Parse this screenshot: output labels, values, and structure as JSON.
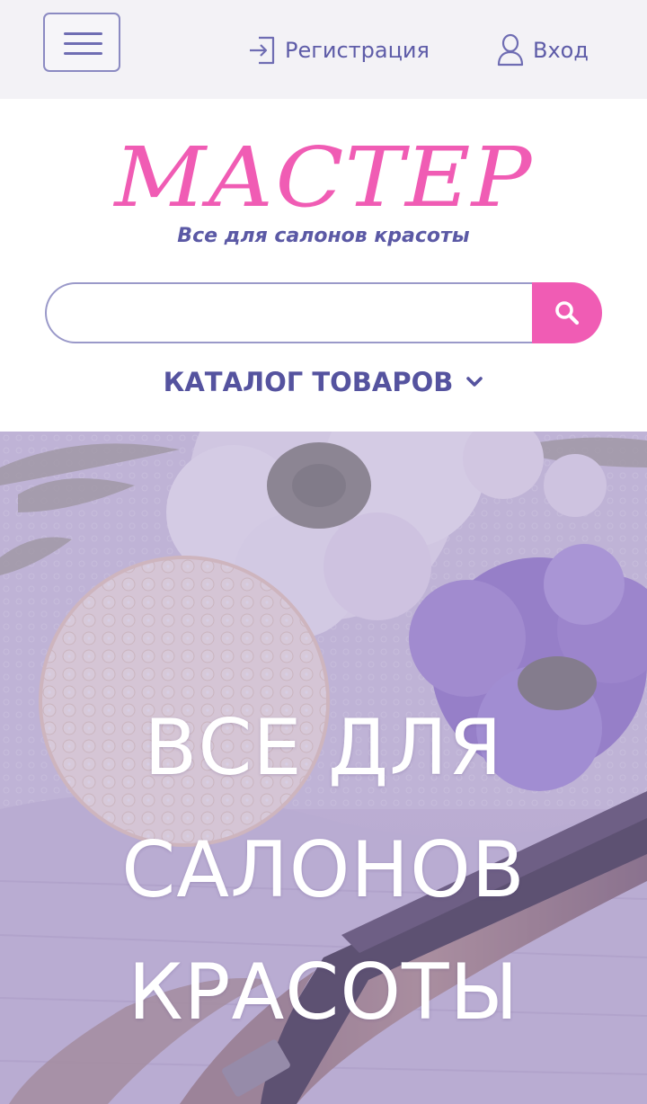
{
  "topbar": {
    "menu_label": "",
    "register_label": "Регистрация",
    "login_label": "Вход"
  },
  "header": {
    "logo": "МАСТЕР",
    "tagline": "Все для салонов красоты"
  },
  "search": {
    "value": "",
    "placeholder": ""
  },
  "catalog": {
    "label": "КАТАЛОГ ТОВАРОВ"
  },
  "hero": {
    "lines": [
      "ВСЕ ДЛЯ",
      "САЛОНОВ",
      "КРАСОТЫ"
    ]
  },
  "colors": {
    "accent_pink": "#f05cb4",
    "brand_purple": "#5e5ca8",
    "topbar_bg": "#f3f2f6",
    "hero_overlay": "#9f8cc4"
  },
  "icons": [
    "menu-icon",
    "register-icon",
    "user-icon",
    "search-icon",
    "chevron-down-icon"
  ]
}
